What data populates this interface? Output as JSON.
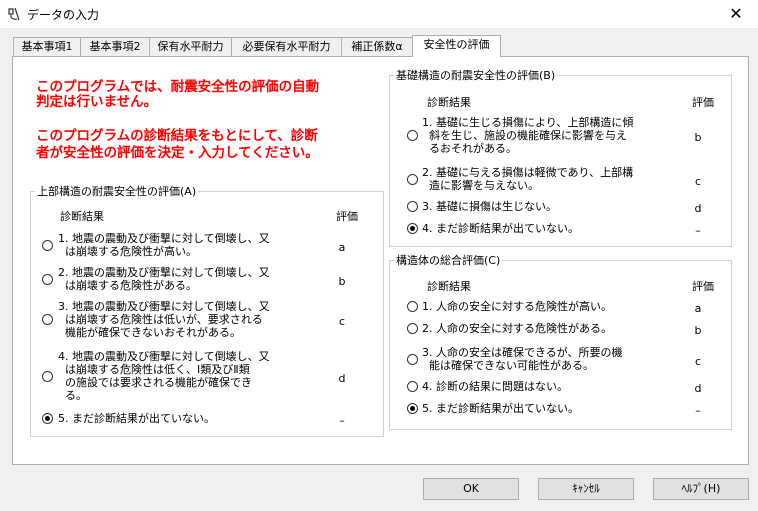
{
  "window": {
    "title": "データの入力",
    "close_glyph": "✕"
  },
  "tabs": [
    "基本事項1",
    "基本事項2",
    "保有水平耐力",
    "必要保有水平耐力",
    "補正係数α",
    "安全性の評価"
  ],
  "notice": {
    "line1": "このプログラムでは、耐震安全性の評価の自動",
    "line2": "判定は行いません。",
    "line3": "このプログラムの診断結果をもとにして、診断",
    "line4": "者が安全性の評価を決定・入力してください。"
  },
  "upper": {
    "legend": "上部構造の耐震安全性の評価(A)",
    "col_result": "診断結果",
    "col_grade": "評価",
    "options": [
      {
        "lines": [
          "1. 地震の震動及び衝撃に対して倒壊し、又",
          "は崩壊する危険性が高い。"
        ],
        "grade": "a",
        "selected": false
      },
      {
        "lines": [
          "2. 地震の震動及び衝撃に対して倒壊し、又",
          "は崩壊する危険性がある。"
        ],
        "grade": "b",
        "selected": false
      },
      {
        "lines": [
          "3. 地震の震動及び衝撃に対して倒壊し、又",
          "は崩壊する危険性は低いが、要求される",
          "機能が確保できないおそれがある。"
        ],
        "grade": "c",
        "selected": false
      },
      {
        "lines": [
          "4. 地震の震動及び衝撃に対して倒壊し、又",
          "は崩壊する危険性は低く、Ⅰ類及びⅡ類",
          "の施設では要求される機能が確保でき",
          "る。"
        ],
        "grade": "d",
        "selected": false
      },
      {
        "lines": [
          "5. まだ診断結果が出ていない。"
        ],
        "grade": "–",
        "selected": true
      }
    ]
  },
  "foundation": {
    "legend": "基礎構造の耐震安全性の評価(B)",
    "col_result": "診断結果",
    "col_grade": "評価",
    "options": [
      {
        "lines": [
          "1. 基礎に生じる損傷により、上部構造に傾",
          "斜を生じ、施設の機能確保に影響を与え",
          "るおそれがある。"
        ],
        "grade": "b",
        "selected": false
      },
      {
        "lines": [
          "2. 基礎に与える損傷は軽微であり、上部構",
          "造に影響を与えない。"
        ],
        "grade": "c",
        "selected": false
      },
      {
        "lines": [
          "3. 基礎に損傷は生じない。"
        ],
        "grade": "d",
        "selected": false
      },
      {
        "lines": [
          "4. まだ診断結果が出ていない。"
        ],
        "grade": "–",
        "selected": true
      }
    ]
  },
  "overall": {
    "legend": "構造体の総合評価(C)",
    "col_result": "診断結果",
    "col_grade": "評価",
    "options": [
      {
        "lines": [
          "1. 人命の安全に対する危険性が高い。"
        ],
        "grade": "a",
        "selected": false
      },
      {
        "lines": [
          "2. 人命の安全に対する危険性がある。"
        ],
        "grade": "b",
        "selected": false
      },
      {
        "lines": [
          "3. 人命の安全は確保できるが、所要の機",
          "能は確保できない可能性がある。"
        ],
        "grade": "c",
        "selected": false
      },
      {
        "lines": [
          "4. 診断の結果に問題はない。"
        ],
        "grade": "d",
        "selected": false
      },
      {
        "lines": [
          "5. まだ診断結果が出ていない。"
        ],
        "grade": "–",
        "selected": true
      }
    ]
  },
  "buttons": {
    "ok": "OK",
    "cancel": "ｷｬﾝｾﾙ",
    "help": "ﾍﾙﾌﾟ(H)"
  }
}
